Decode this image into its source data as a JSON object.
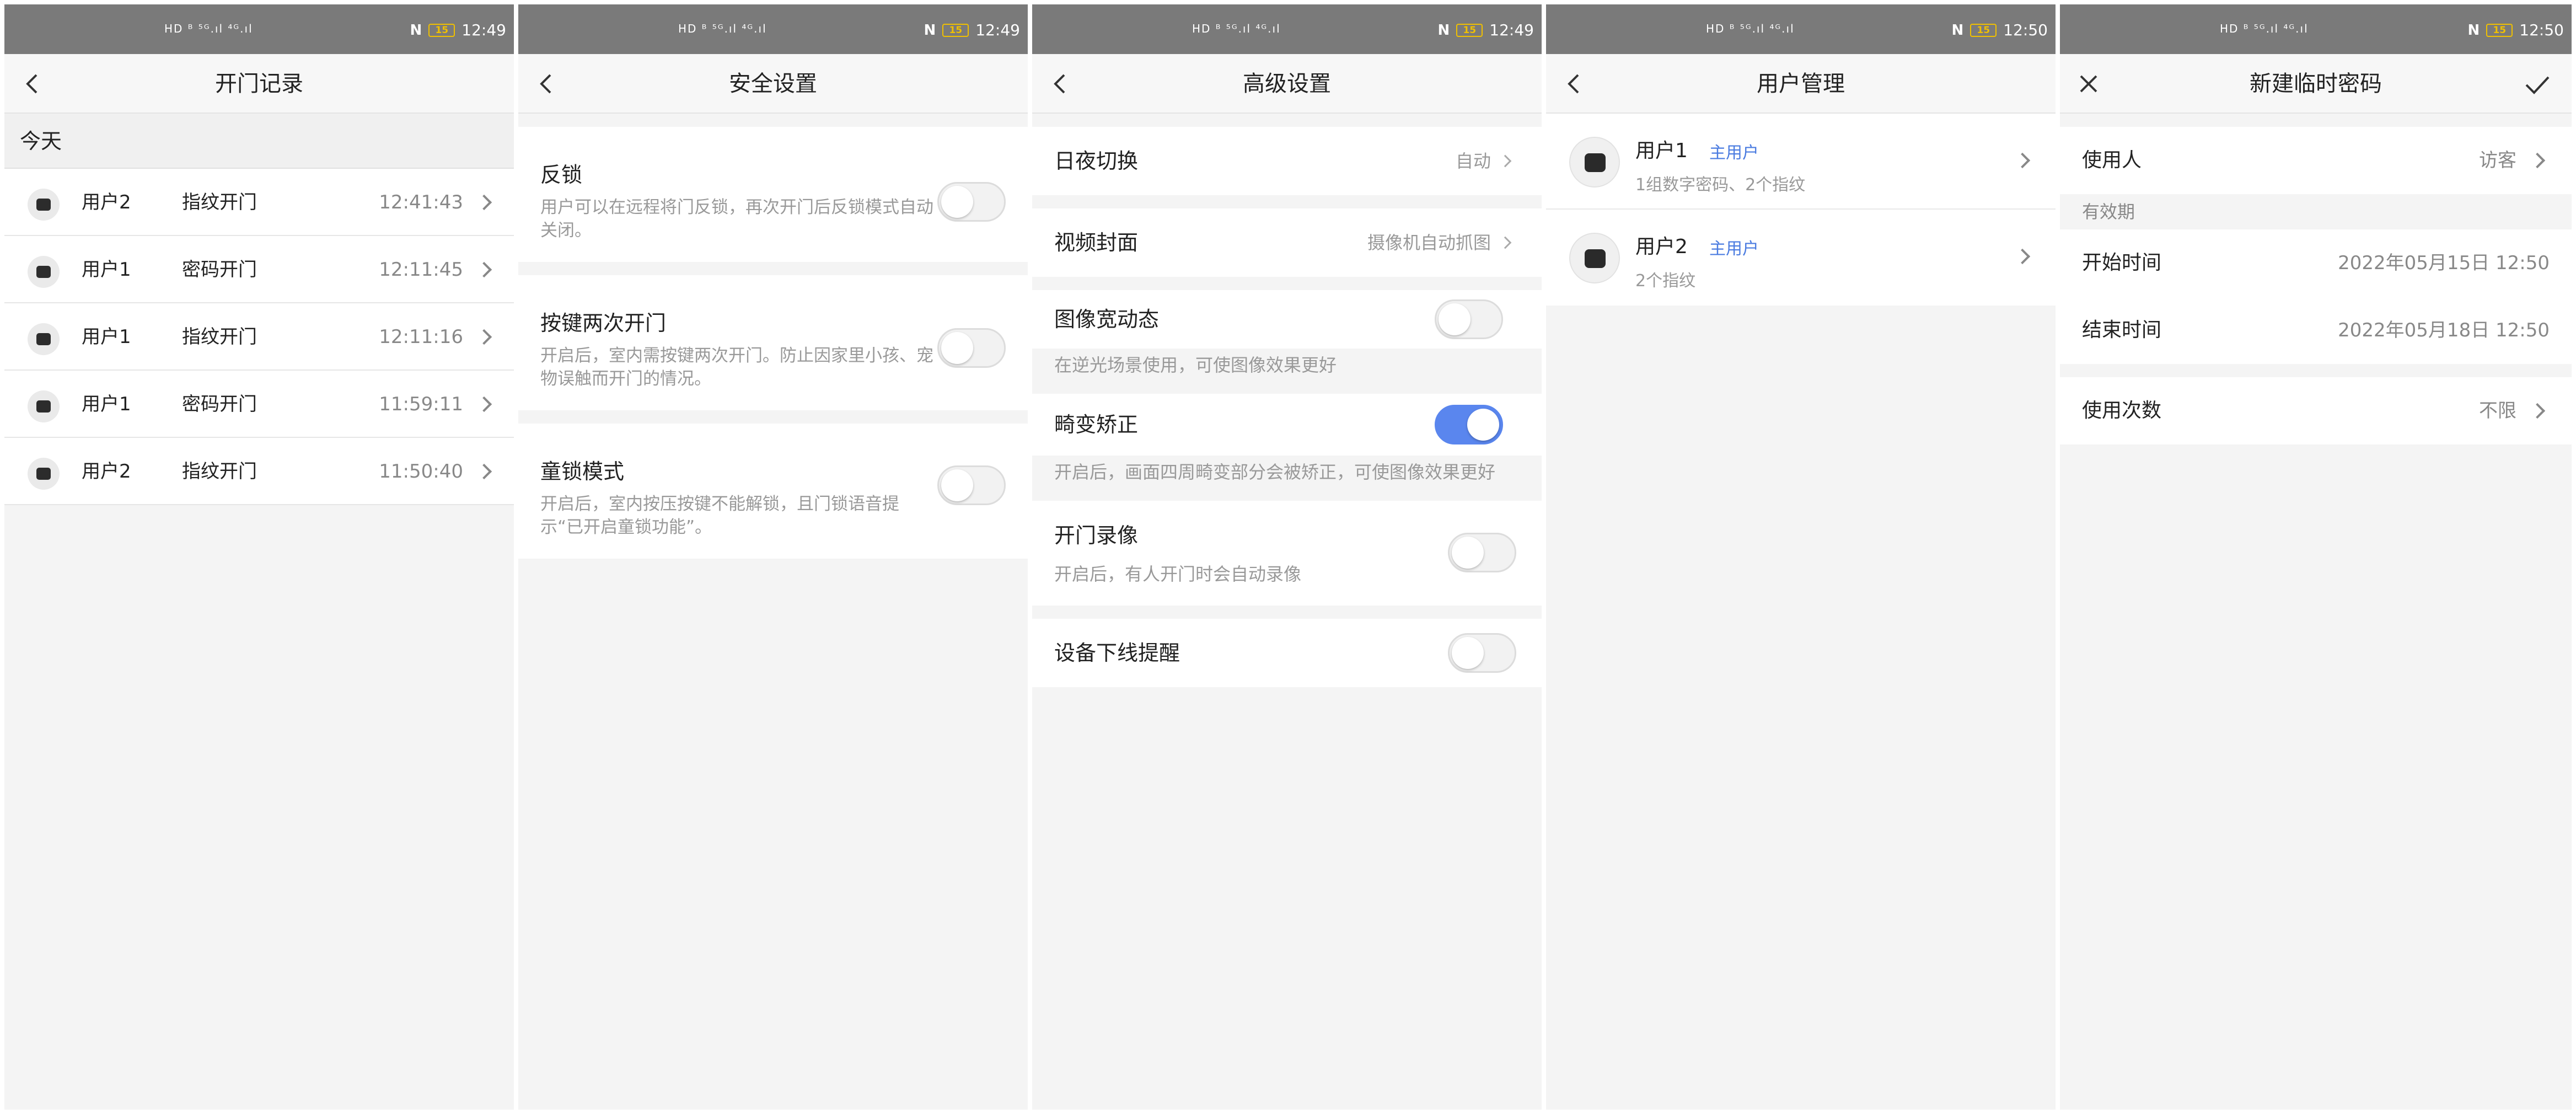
{
  "status": {
    "carrier_icons": "HD ᴮ ⁵ᴳ.ıl ⁴ᴳ.ıl",
    "nfc": "N",
    "battery": "15"
  },
  "screens": [
    {
      "time": "12:49",
      "title": "开门记录",
      "section": "今天",
      "records": [
        {
          "user": "用户2",
          "method": "指纹开门",
          "time": "12:41:43"
        },
        {
          "user": "用户1",
          "method": "密码开门",
          "time": "12:11:45"
        },
        {
          "user": "用户1",
          "method": "指纹开门",
          "time": "12:11:16"
        },
        {
          "user": "用户1",
          "method": "密码开门",
          "time": "11:59:11"
        },
        {
          "user": "用户2",
          "method": "指纹开门",
          "time": "11:50:40"
        }
      ]
    },
    {
      "time": "12:49",
      "title": "安全设置",
      "items": [
        {
          "title": "反锁",
          "desc": "用户可以在远程将门反锁，再次开门后反锁模式自动关闭。",
          "enabled": false
        },
        {
          "title": "按键两次开门",
          "desc": "开启后，室内需按键两次开门。防止因家里小孩、宠物误触而开门的情况。",
          "enabled": false
        },
        {
          "title": "童锁模式",
          "desc": "开启后，室内按压按键不能解锁，且门锁语音提示“已开启童锁功能”。",
          "enabled": false
        }
      ]
    },
    {
      "time": "12:49",
      "title": "高级设置",
      "day_night": {
        "label": "日夜切换",
        "value": "自动"
      },
      "video_cover": {
        "label": "视频封面",
        "value": "摄像机自动抓图"
      },
      "wdr": {
        "label": "图像宽动态",
        "hint": "在逆光场景使用，可使图像效果更好",
        "enabled": false
      },
      "distortion": {
        "label": "畸变矫正",
        "hint": "开启后，画面四周畸变部分会被矫正，可使图像效果更好",
        "enabled": true
      },
      "door_record": {
        "label": "开门录像",
        "hint": "开启后，有人开门时会自动录像",
        "enabled": false
      },
      "offline_alert": {
        "label": "设备下线提醒",
        "enabled": false
      }
    },
    {
      "time": "12:50",
      "title": "用户管理",
      "users": [
        {
          "name": "用户1",
          "role": "主用户",
          "desc": "1组数字密码、2个指纹"
        },
        {
          "name": "用户2",
          "role": "主用户",
          "desc": "2个指纹"
        }
      ]
    },
    {
      "time": "12:50",
      "title": "新建临时密码",
      "user_label": "使用人",
      "user_value": "访客",
      "validity_header": "有效期",
      "start_label": "开始时间",
      "start_value": "2022年05月15日 12:50",
      "end_label": "结束时间",
      "end_value": "2022年05月18日 12:50",
      "count_label": "使用次数",
      "count_value": "不限"
    }
  ],
  "colors": {
    "accent": "#5a86ee",
    "role_text": "#4a7be0",
    "status_bar": "#7a7a7a"
  },
  "icons": {
    "back": "chevron-left-icon",
    "close": "close-icon",
    "confirm": "check-icon",
    "row_arrow": "chevron-right-icon"
  }
}
